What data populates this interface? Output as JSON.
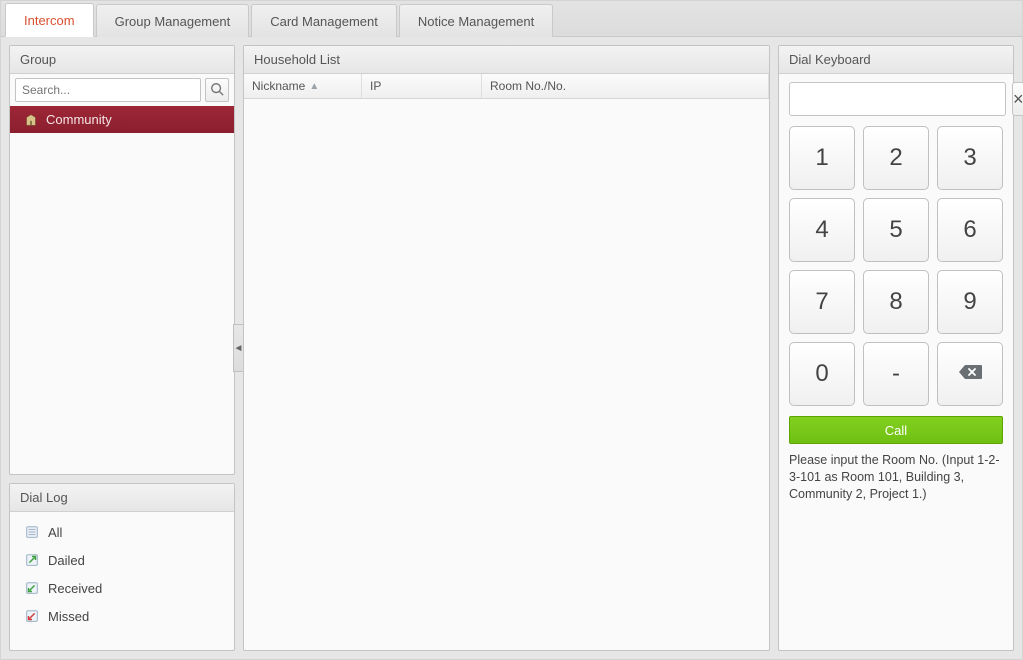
{
  "tabs": {
    "items": [
      {
        "label": "Intercom"
      },
      {
        "label": "Group Management"
      },
      {
        "label": "Card Management"
      },
      {
        "label": "Notice Management"
      }
    ],
    "active_index": 0
  },
  "group": {
    "title": "Group",
    "search": {
      "placeholder": "Search..."
    },
    "tree": [
      {
        "label": "Community",
        "selected": true,
        "icon": "org-icon"
      }
    ]
  },
  "dial_log": {
    "title": "Dial Log",
    "items": [
      {
        "label": "All",
        "icon": "log-all-icon"
      },
      {
        "label": "Dailed",
        "icon": "log-dialed-icon"
      },
      {
        "label": "Received",
        "icon": "log-received-icon"
      },
      {
        "label": "Missed",
        "icon": "log-missed-icon"
      }
    ]
  },
  "household": {
    "title": "Household List",
    "columns": [
      {
        "key": "nickname",
        "label": "Nickname",
        "sort": "asc"
      },
      {
        "key": "ip",
        "label": "IP"
      },
      {
        "key": "room",
        "label": "Room No./No."
      }
    ],
    "rows": []
  },
  "dial": {
    "title": "Dial Keyboard",
    "display_value": "",
    "keys": [
      "1",
      "2",
      "3",
      "4",
      "5",
      "6",
      "7",
      "8",
      "9",
      "0",
      "-",
      "backspace"
    ],
    "call_label": "Call",
    "help": "Please input the Room No. (Input 1-2-3-101 as Room 101, Building 3, Community 2, Project 1.)"
  }
}
